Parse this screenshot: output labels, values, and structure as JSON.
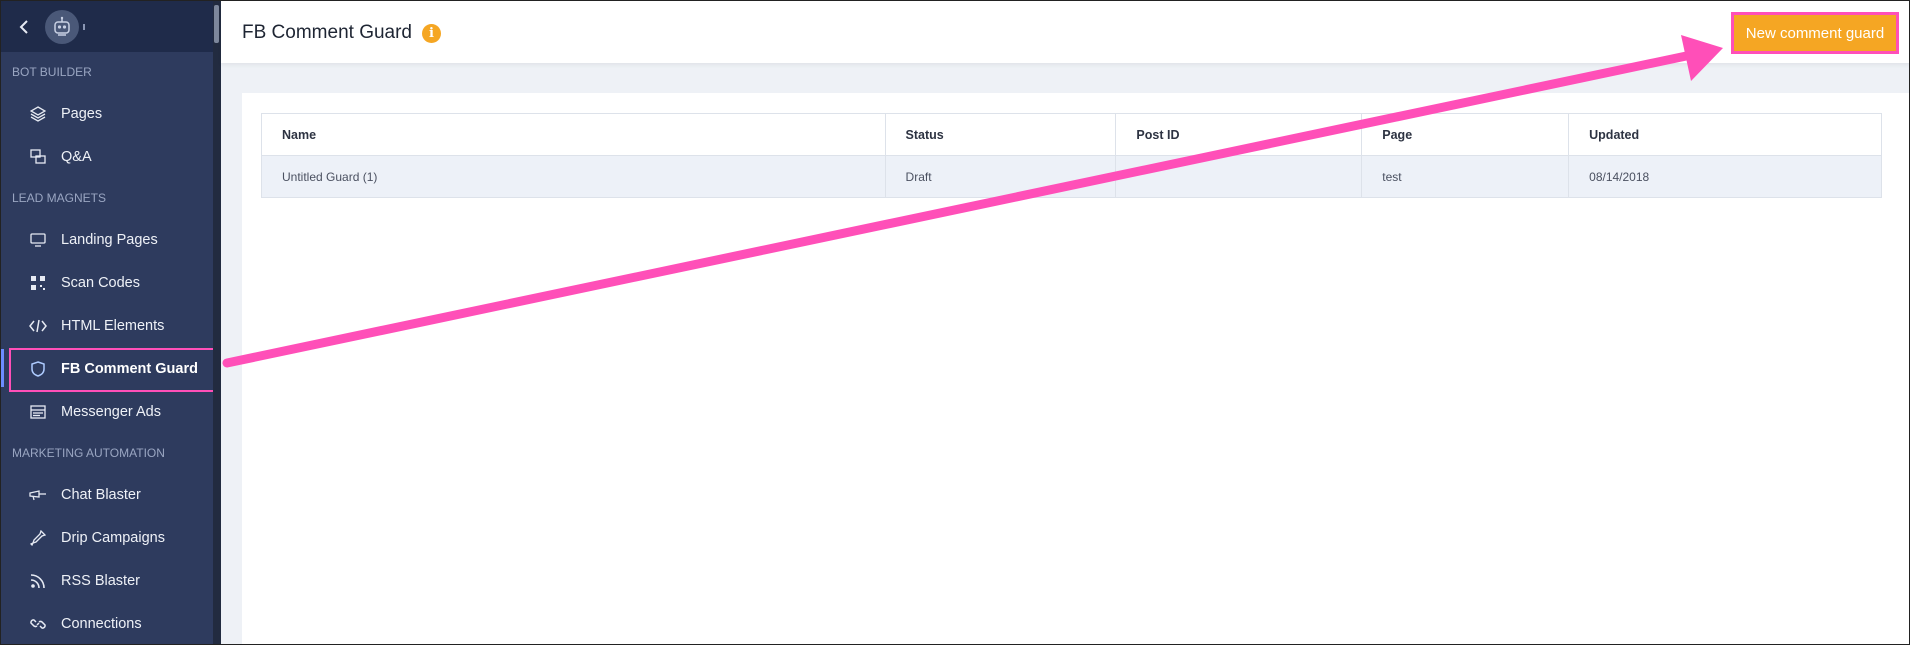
{
  "sidebar": {
    "sections": [
      {
        "label": "BOT BUILDER"
      },
      {
        "label": "LEAD MAGNETS"
      },
      {
        "label": "MARKETING AUTOMATION"
      }
    ],
    "items": [
      {
        "label": "Pages",
        "icon": "layers-icon"
      },
      {
        "label": "Q&A",
        "icon": "qa-icon"
      },
      {
        "label": "Landing Pages",
        "icon": "monitor-icon"
      },
      {
        "label": "Scan Codes",
        "icon": "qr-code-icon"
      },
      {
        "label": "HTML Elements",
        "icon": "code-icon"
      },
      {
        "label": "FB Comment Guard",
        "icon": "shield-icon",
        "active": true
      },
      {
        "label": "Messenger Ads",
        "icon": "ads-icon"
      },
      {
        "label": "Chat Blaster",
        "icon": "megaphone-icon"
      },
      {
        "label": "Drip Campaigns",
        "icon": "dropper-icon"
      },
      {
        "label": "RSS Blaster",
        "icon": "rss-icon"
      },
      {
        "label": "Connections",
        "icon": "link-icon"
      }
    ]
  },
  "header": {
    "title": "FB Comment Guard",
    "info_icon": "i",
    "new_button": "New comment guard"
  },
  "table": {
    "columns": [
      "Name",
      "Status",
      "Post ID",
      "Page",
      "Updated"
    ],
    "rows": [
      [
        "Untitled Guard (1)",
        "Draft",
        "",
        "test",
        "08/14/2018"
      ]
    ]
  },
  "colors": {
    "sidebar_bg": "#2e3b5e",
    "accent_orange": "#f5a623",
    "annotation_pink": "#ff4fb8"
  }
}
